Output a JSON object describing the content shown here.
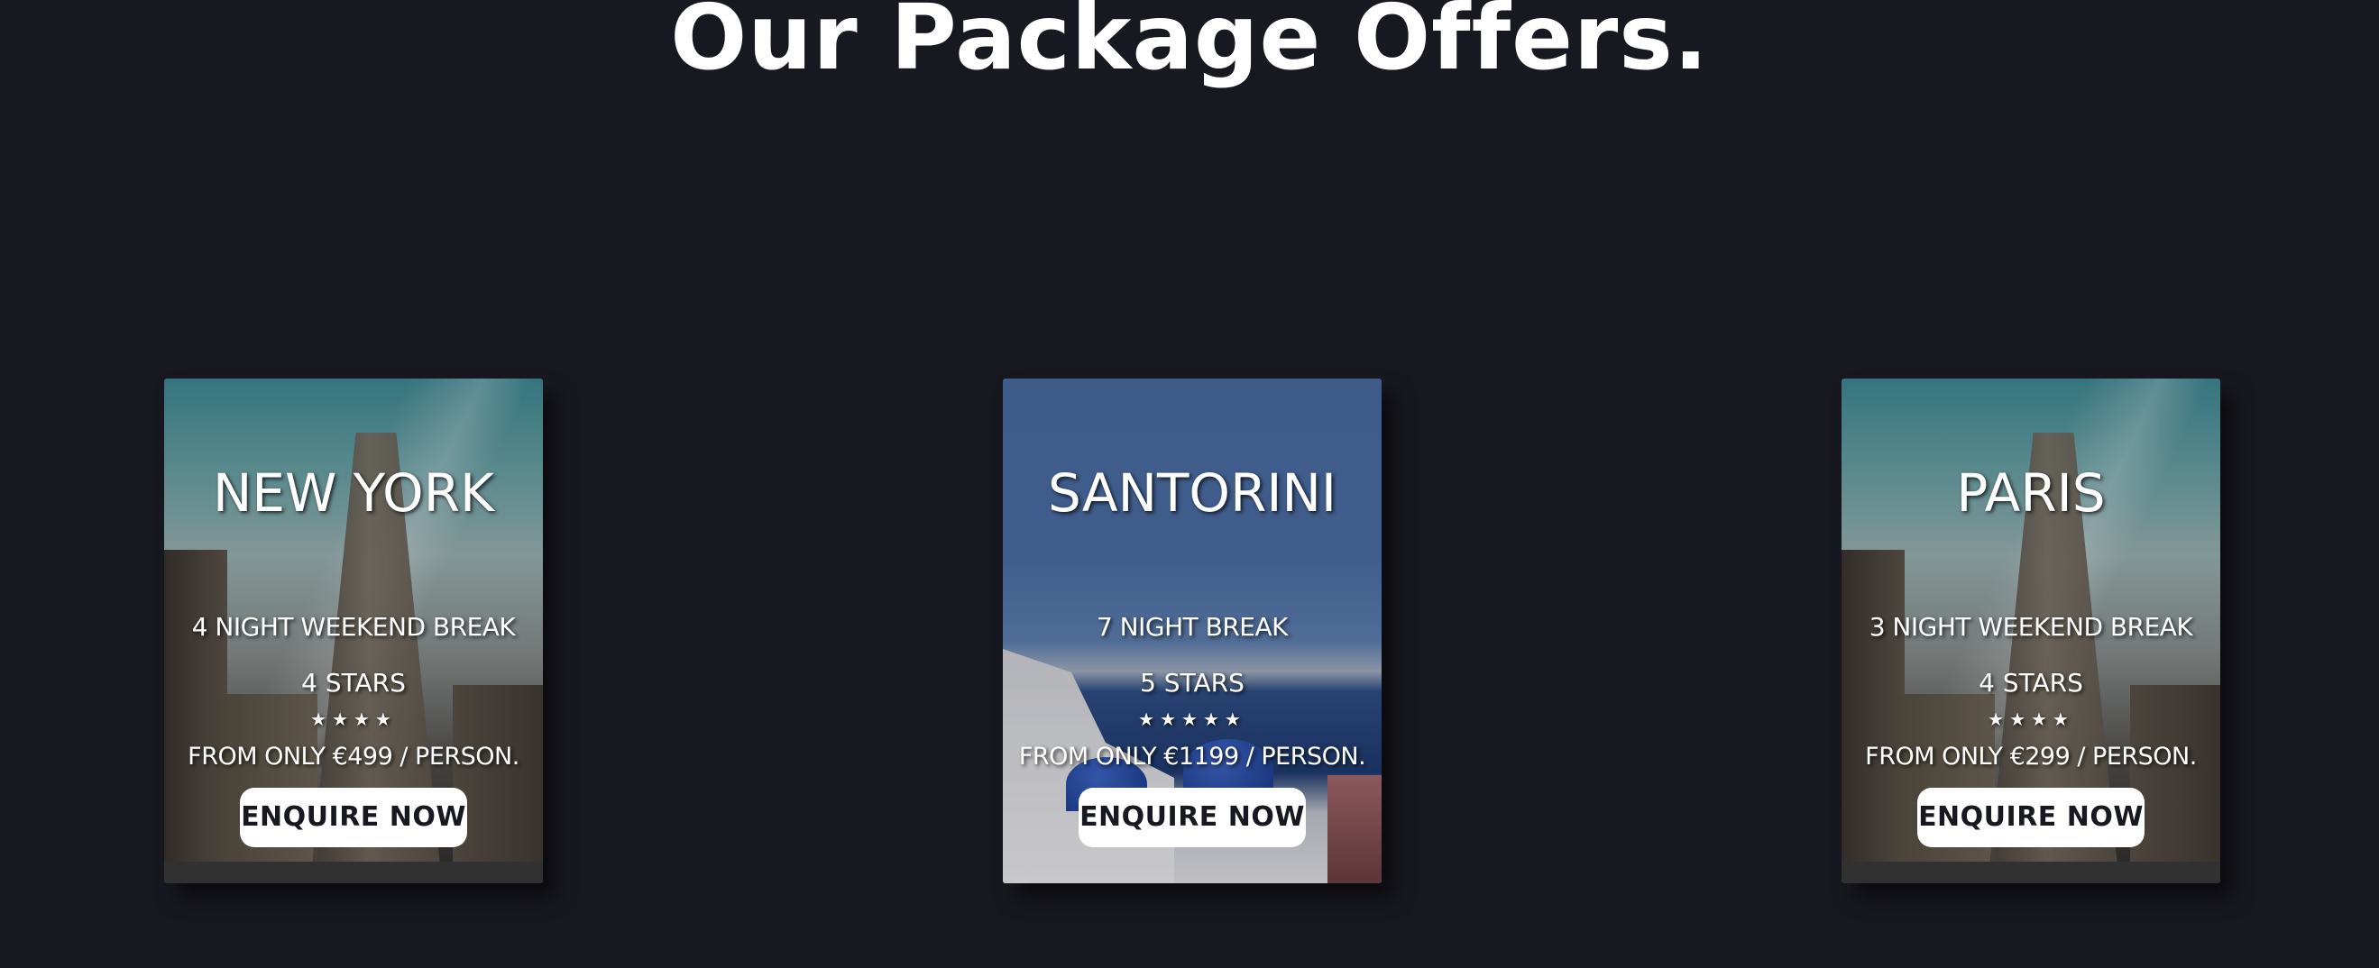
{
  "section": {
    "title": "Our Package Offers."
  },
  "cards": [
    {
      "destination": "NEW YORK",
      "nights": "4 NIGHT WEEKEND BREAK",
      "stars_text": "4 STARS",
      "star_rating": 4,
      "stars": "★★★★",
      "price": "FROM ONLY €499 / PERSON.",
      "button": "ENQUIRE NOW",
      "image": "flatiron-building-photo"
    },
    {
      "destination": "SANTORINI",
      "nights": "7 NIGHT BREAK",
      "stars_text": "5 STARS",
      "star_rating": 5,
      "stars": "★★★★★",
      "price": "FROM ONLY €1199 / PERSON.",
      "button": "ENQUIRE NOW",
      "image": "santorini-coast-photo"
    },
    {
      "destination": "PARIS",
      "nights": "3 NIGHT WEEKEND BREAK",
      "stars_text": "4 STARS",
      "star_rating": 4,
      "stars": "★★★★",
      "price": "FROM ONLY €299 / PERSON.",
      "button": "ENQUIRE NOW",
      "image": "flatiron-building-photo"
    }
  ],
  "colors": {
    "page_background": "#181820",
    "text": "#ffffff",
    "button_background": "#ffffff",
    "button_text": "#181820"
  }
}
